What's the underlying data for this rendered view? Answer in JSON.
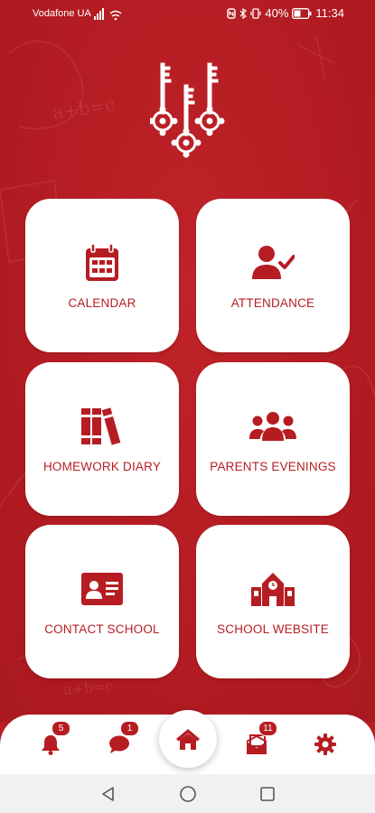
{
  "status_bar": {
    "carrier": "Vodafone UA",
    "battery": "40%",
    "time": "11:34"
  },
  "tiles": [
    {
      "label": "CALENDAR",
      "icon": "calendar-icon"
    },
    {
      "label": "ATTENDANCE",
      "icon": "user-check-icon"
    },
    {
      "label": "HOMEWORK DIARY",
      "icon": "books-icon"
    },
    {
      "label": "PARENTS EVENINGS",
      "icon": "users-icon"
    },
    {
      "label": "CONTACT SCHOOL",
      "icon": "id-card-icon"
    },
    {
      "label": "SCHOOL WEBSITE",
      "icon": "school-icon"
    }
  ],
  "tabbar": {
    "notifications_badge": "5",
    "messages_badge": "1",
    "mail_badge": "11"
  },
  "background_doodles": [
    "a+b=c",
    "a+b=c"
  ],
  "colors": {
    "brand": "#b61d23",
    "tile": "#ffffff"
  }
}
